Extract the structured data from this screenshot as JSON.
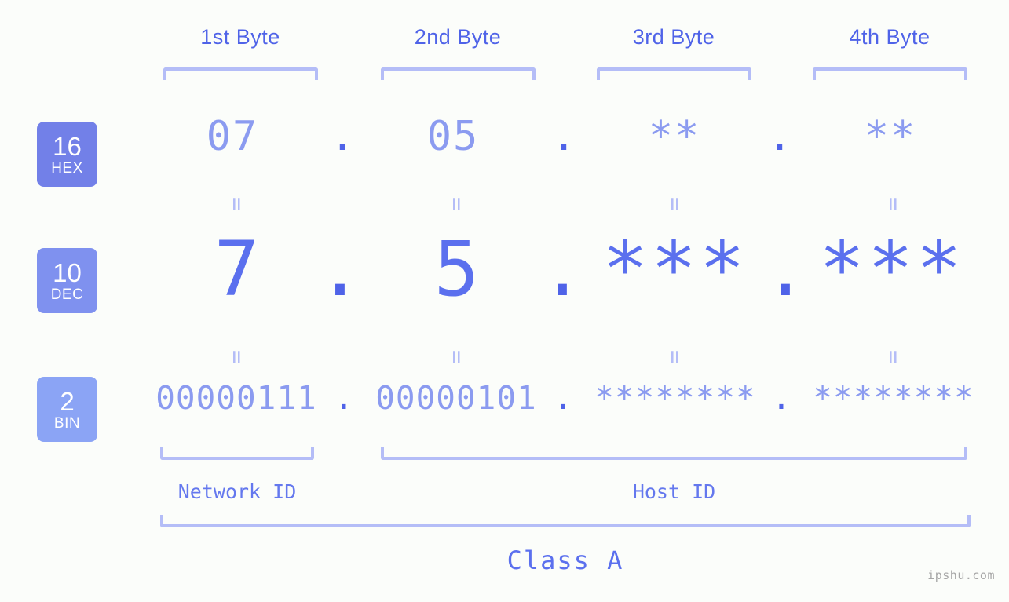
{
  "colors": {
    "background": "#fbfdfa",
    "accent_strong": "#4f63e8",
    "accent_mid": "#5b70ee",
    "accent_light": "#8b9bf0",
    "bracket": "#b4bdf7",
    "badge_hex": "#7280e8",
    "badge_dec": "#7f91ef",
    "badge_bin": "#8ba4f5",
    "watermark": "#a6a6a6"
  },
  "byte_headers": [
    {
      "label": "1st Byte"
    },
    {
      "label": "2nd Byte"
    },
    {
      "label": "3rd Byte"
    },
    {
      "label": "4th Byte"
    }
  ],
  "bases": [
    {
      "number": "16",
      "name": "HEX"
    },
    {
      "number": "10",
      "name": "DEC"
    },
    {
      "number": "2",
      "name": "BIN"
    }
  ],
  "rows": {
    "hex": {
      "values": [
        "07",
        "05",
        "**",
        "**"
      ],
      "separator": "."
    },
    "dec": {
      "values": [
        "7",
        "5",
        "***",
        "***"
      ],
      "separator": "."
    },
    "bin": {
      "values": [
        "00000111",
        "00000101",
        "********",
        "********"
      ],
      "separator": "."
    }
  },
  "equals_mark": "=",
  "id_labels": [
    {
      "text": "Network ID"
    },
    {
      "text": "Host ID"
    }
  ],
  "class_label": "Class A",
  "watermark": "ipshu.com"
}
